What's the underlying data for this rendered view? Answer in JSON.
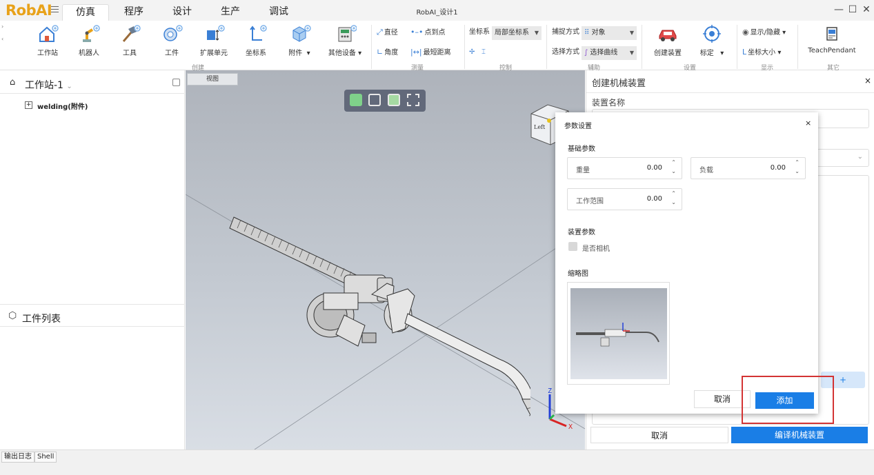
{
  "app": {
    "logo": "RobAI",
    "window_title": "RobAI_设计1",
    "menu_tabs": [
      "仿真",
      "程序",
      "设计",
      "生产",
      "调试"
    ],
    "active_tab": "仿真",
    "window_controls": {
      "minimize": "—",
      "maximize": "☐",
      "close": "✕"
    }
  },
  "ribbon": {
    "create": {
      "group_label": "创建",
      "buttons": [
        "工作站",
        "机器人",
        "工具",
        "工件",
        "扩展单元",
        "坐标系",
        "附件",
        "其他设备"
      ]
    },
    "measure": {
      "group_label": "测量",
      "items": [
        "直径",
        "点到点",
        "角度",
        "最短距离"
      ]
    },
    "control": {
      "group_label": "控制",
      "coord_label": "坐标系",
      "coord_value": "局部坐标系"
    },
    "assist": {
      "group_label": "辅助",
      "capture_label": "捕捉方式",
      "capture_value": "对象",
      "select_label": "选择方式",
      "select_value": "选择曲线"
    },
    "settings": {
      "group_label": "设置",
      "buttons": [
        "创建装置",
        "标定"
      ]
    },
    "display": {
      "group_label": "显示",
      "show_hide": "显示/隐藏",
      "coord_size": "坐标大小"
    },
    "other": {
      "group_label": "其它",
      "teach_pendant": "TeachPendant"
    }
  },
  "left_panel": {
    "station_title": "工作站-1",
    "tree_item": "welding(附件)",
    "workpiece_list_title": "工件列表"
  },
  "viewport": {
    "tab_label": "视图",
    "view_cube_face": "Left",
    "axis_z": "Z",
    "axis_x": "X"
  },
  "right_panel": {
    "title": "创建机械装置",
    "device_name_label": "装置名称",
    "add_symbol": "+",
    "cancel_button": "取消",
    "compile_button": "编译机械装置"
  },
  "dialog": {
    "title": "参数设置",
    "basic_params_label": "基础参数",
    "weight_label": "重量",
    "weight_value": "0.00",
    "load_label": "负载",
    "load_value": "0.00",
    "work_range_label": "工作范围",
    "work_range_value": "0.00",
    "device_params_label": "装置参数",
    "is_camera_label": "是否相机",
    "is_camera_checked": false,
    "thumbnail_label": "缩略图",
    "cancel_button": "取消",
    "add_button": "添加",
    "close": "×"
  },
  "status_bar": {
    "tabs": [
      "输出日志",
      "Shell"
    ]
  },
  "colors": {
    "accent": "#1a7ee6",
    "logo": "#e8a21a",
    "highlight": "#d33333"
  }
}
